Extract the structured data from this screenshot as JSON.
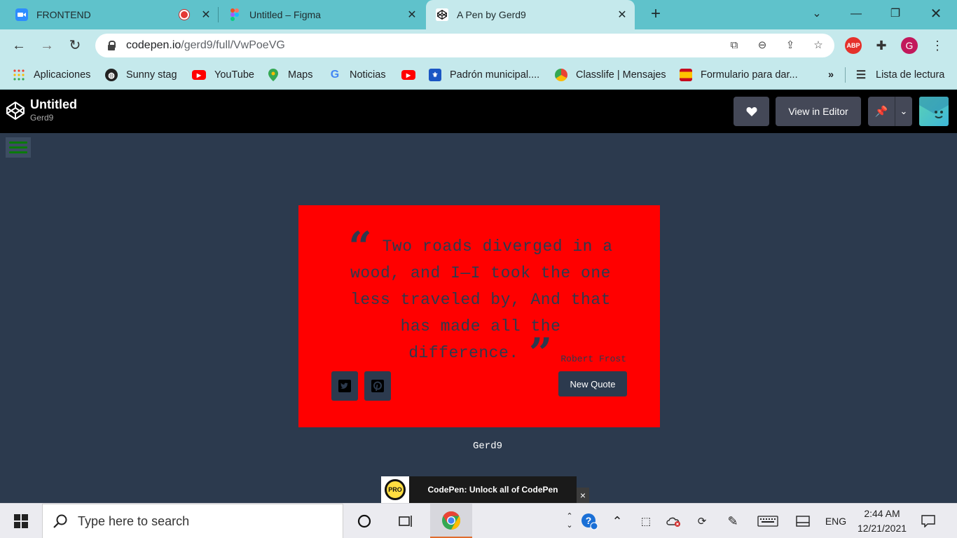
{
  "browser": {
    "tabs": [
      {
        "title": "FRONTEND",
        "icon": "zoom-icon",
        "recording": true
      },
      {
        "title": "Untitled – Figma",
        "icon": "figma-icon"
      },
      {
        "title": "A Pen by Gerd9",
        "icon": "codepen-icon",
        "active": true
      }
    ],
    "url": {
      "host": "codepen.io",
      "path": "/gerd9/full/VwPoeVG"
    },
    "profile_initial": "G",
    "extension_abp": "ABP",
    "bookmarks": [
      {
        "label": "Aplicaciones",
        "icon": "apps-grid-icon"
      },
      {
        "label": "Sunny stag",
        "icon": "globe-icon"
      },
      {
        "label": "YouTube",
        "icon": "youtube-icon"
      },
      {
        "label": "Maps",
        "icon": "maps-pin-icon"
      },
      {
        "label": "Noticias",
        "icon": "google-icon"
      },
      {
        "label": "",
        "icon": "youtube-icon"
      },
      {
        "label": "Padrón municipal....",
        "icon": "shield-icon"
      },
      {
        "label": "Classlife | Mensajes",
        "icon": "chrome-like-icon"
      },
      {
        "label": "Formulario para dar...",
        "icon": "flag-es-icon"
      }
    ],
    "bookmarks_overflow": "»",
    "reading_list": "Lista de lectura"
  },
  "codepen": {
    "title": "Untitled",
    "user": "Gerd9",
    "view_in_editor": "View in Editor"
  },
  "pen": {
    "quote": "Two roads diverged in a wood, and I—I took the one less traveled by, And that has made all the difference.",
    "author": "Robert Frost",
    "new_quote_label": "New Quote",
    "footer": "Gerd9",
    "colors": {
      "background": "#2c3a4e",
      "card": "#ff0000",
      "menu_lines": "#0a7a0a"
    }
  },
  "promo": {
    "badge": "PRO",
    "text": "CodePen: Unlock all of CodePen",
    "close": "×"
  },
  "taskbar": {
    "search_placeholder": "Type here to search",
    "language": "ENG",
    "time": "2:44 AM",
    "date": "12/21/2021"
  }
}
